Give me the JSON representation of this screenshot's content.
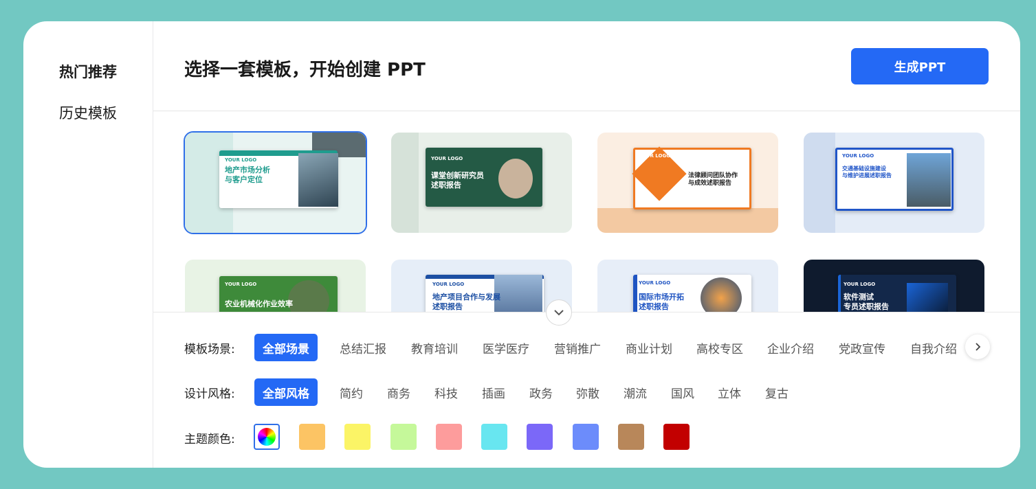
{
  "sidebar": {
    "items": [
      {
        "label": "热门推荐"
      },
      {
        "label": "历史模板"
      }
    ]
  },
  "header": {
    "title": "选择一套模板，开始创建 PPT",
    "generate_label": "生成PPT"
  },
  "templates": [
    {
      "logo": "YOUR LOGO",
      "title": "地产市场分析\n与客户定位",
      "bg": "#e9f4f2",
      "accent": "#1f9c8e"
    },
    {
      "logo": "YOUR LOGO",
      "title": "课堂创新研究员\n述职报告",
      "bg": "#e8efe9",
      "accent": "#245a45"
    },
    {
      "logo": "YOUR LOGO",
      "title": "法律顾问团队协作\n与成效述职报告",
      "bg": "#fbeee2",
      "accent": "#f07a22"
    },
    {
      "logo": "YOUR LOGO",
      "title": "交通基础设施建设\n与维护进展述职报告",
      "bg": "#e4ecf7",
      "accent": "#2156c8"
    },
    {
      "logo": "YOUR LOGO",
      "title": "农业机械化作业效率",
      "bg": "#e8f3e5",
      "accent": "#3e8a3a"
    },
    {
      "logo": "YOUR LOGO",
      "title": "地产项目合作与发展\n述职报告",
      "bg": "#e6eef8",
      "accent": "#1c4fa3"
    },
    {
      "logo": "YOUR LOGO",
      "title": "国际市场开拓\n述职报告",
      "bg": "#e7eef8",
      "accent": "#1f54c2"
    },
    {
      "logo": "YOUR LOGO",
      "title": "软件测试\n专员述职报告",
      "bg": "#0f1b2e",
      "accent": "#1a64d6"
    }
  ],
  "filters": {
    "scene_label": "模板场景:",
    "scenes": [
      "全部场景",
      "总结汇报",
      "教育培训",
      "医学医疗",
      "营销推广",
      "商业计划",
      "高校专区",
      "企业介绍",
      "党政宣传",
      "自我介绍"
    ],
    "style_label": "设计风格:",
    "styles": [
      "全部风格",
      "简约",
      "商务",
      "科技",
      "插画",
      "政务",
      "弥散",
      "潮流",
      "国风",
      "立体",
      "复古"
    ],
    "color_label": "主题颜色:",
    "colors": [
      "#fcc464",
      "#fbf466",
      "#c5f89a",
      "#fd9c9c",
      "#68e6f0",
      "#7b68f8",
      "#6c8cfb",
      "#b8875a",
      "#c20000"
    ]
  }
}
